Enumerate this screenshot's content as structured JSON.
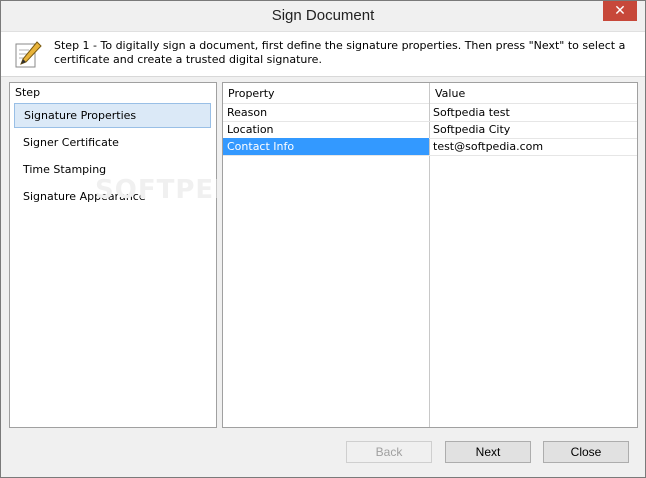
{
  "window": {
    "title": "Sign Document",
    "close_glyph": "✕"
  },
  "header": {
    "icon": "pen-paper-icon",
    "text": "Step 1 - To digitally sign a document, first define the signature properties. Then press \"Next\" to select a certificate and create a trusted digital signature."
  },
  "steps": {
    "header": "Step",
    "items": [
      {
        "label": "Signature Properties",
        "selected": true
      },
      {
        "label": "Signer Certificate",
        "selected": false
      },
      {
        "label": "Time Stamping",
        "selected": false
      },
      {
        "label": "Signature Appearance",
        "selected": false
      }
    ]
  },
  "grid": {
    "columns": [
      "Property",
      "Value"
    ],
    "rows": [
      {
        "property": "Reason",
        "value": "Softpedia test",
        "selected": false
      },
      {
        "property": "Location",
        "value": "Softpedia City",
        "selected": false
      },
      {
        "property": "Contact Info",
        "value": "test@softpedia.com",
        "selected": true
      }
    ]
  },
  "buttons": {
    "back": "Back",
    "next": "Next",
    "close": "Close"
  },
  "watermark": "SOFTPEDIA",
  "colors": {
    "selection": "#3399ff",
    "step_selected_bg": "#dbe9f7",
    "close_button": "#c7483a"
  }
}
